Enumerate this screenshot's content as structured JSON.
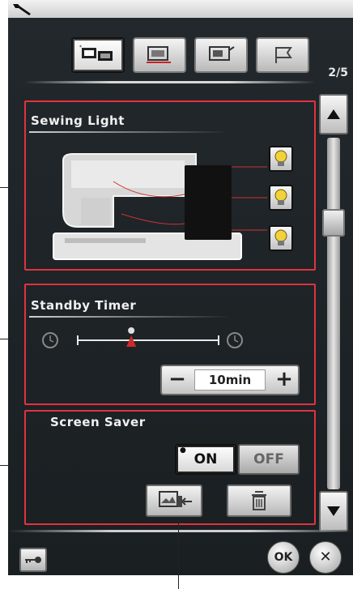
{
  "header": {
    "tabs": [
      {
        "icon": "machine-settings-icon",
        "active": true
      },
      {
        "icon": "embroidery-settings-icon",
        "active": false
      },
      {
        "icon": "display-settings-icon",
        "active": false
      },
      {
        "icon": "language-flag-icon",
        "active": false
      }
    ],
    "page_indicator": "2/5"
  },
  "sewing_light": {
    "title": "Sewing Light",
    "bulbs": [
      "bulb-icon",
      "bulb-icon",
      "bulb-icon"
    ]
  },
  "standby_timer": {
    "title": "Standby Timer",
    "value": "10min",
    "minus_label": "−",
    "plus_label": "+",
    "slider_level": 0.38
  },
  "screen_saver": {
    "title": "Screen Saver",
    "on_label": "ON",
    "off_label": "OFF",
    "selected": "ON"
  },
  "footer": {
    "ok_label": "OK",
    "close_label": "✕"
  },
  "colors": {
    "panel_border": "#e0333f",
    "screen_bg": "#1e2326",
    "bulb_yellow": "#f2d23a",
    "slider_red": "#cc2b2b"
  }
}
